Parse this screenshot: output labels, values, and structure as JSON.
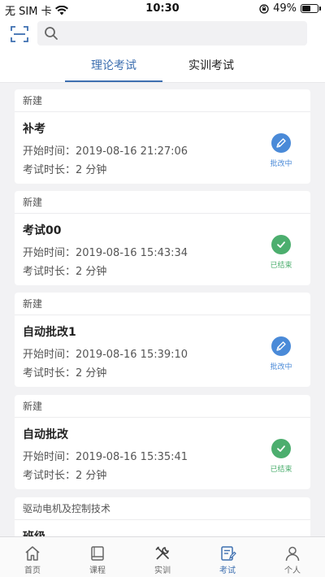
{
  "status_bar": {
    "carrier": "无 SIM 卡",
    "time": "10:30",
    "battery": "49%",
    "battery_level": 0.49
  },
  "search": {
    "placeholder": ""
  },
  "tabs": [
    {
      "label": "理论考试",
      "active": true
    },
    {
      "label": "实训考试",
      "active": false
    }
  ],
  "exams": [
    {
      "category": "新建",
      "name": "补考",
      "start": "开始时间：2019-08-16 21:27:06",
      "duration": "考试时长：2 分钟",
      "status": "批改中",
      "status_icon": "pencil-icon",
      "status_color": "#4a8ad8"
    },
    {
      "category": "新建",
      "name": "考试00",
      "start": "开始时间：2019-08-16 15:43:34",
      "duration": "考试时长：2 分钟",
      "status": "已结束",
      "status_icon": "check-icon",
      "status_color": "#4cae6e"
    },
    {
      "category": "新建",
      "name": "自动批改1",
      "start": "开始时间：2019-08-16 15:39:10",
      "duration": "考试时长：2 分钟",
      "status": "批改中",
      "status_icon": "pencil-icon",
      "status_color": "#4a8ad8"
    },
    {
      "category": "新建",
      "name": "自动批改",
      "start": "开始时间：2019-08-16 15:35:41",
      "duration": "考试时长：2 分钟",
      "status": "已结束",
      "status_icon": "check-icon",
      "status_color": "#4cae6e"
    },
    {
      "category": "驱动电机及控制技术",
      "name": "班级",
      "start": "",
      "duration": "",
      "status": "",
      "status_icon": "",
      "status_color": ""
    }
  ],
  "nav": [
    {
      "label": "首页",
      "icon": "home-icon",
      "active": false
    },
    {
      "label": "课程",
      "icon": "book-icon",
      "active": false
    },
    {
      "label": "实训",
      "icon": "tools-icon",
      "active": false
    },
    {
      "label": "考试",
      "icon": "exam-icon",
      "active": true
    },
    {
      "label": "个人",
      "icon": "person-icon",
      "active": false
    }
  ],
  "colors": {
    "accent": "#3d6fb0",
    "status_blue": "#4a8ad8",
    "status_green": "#4cae6e"
  }
}
